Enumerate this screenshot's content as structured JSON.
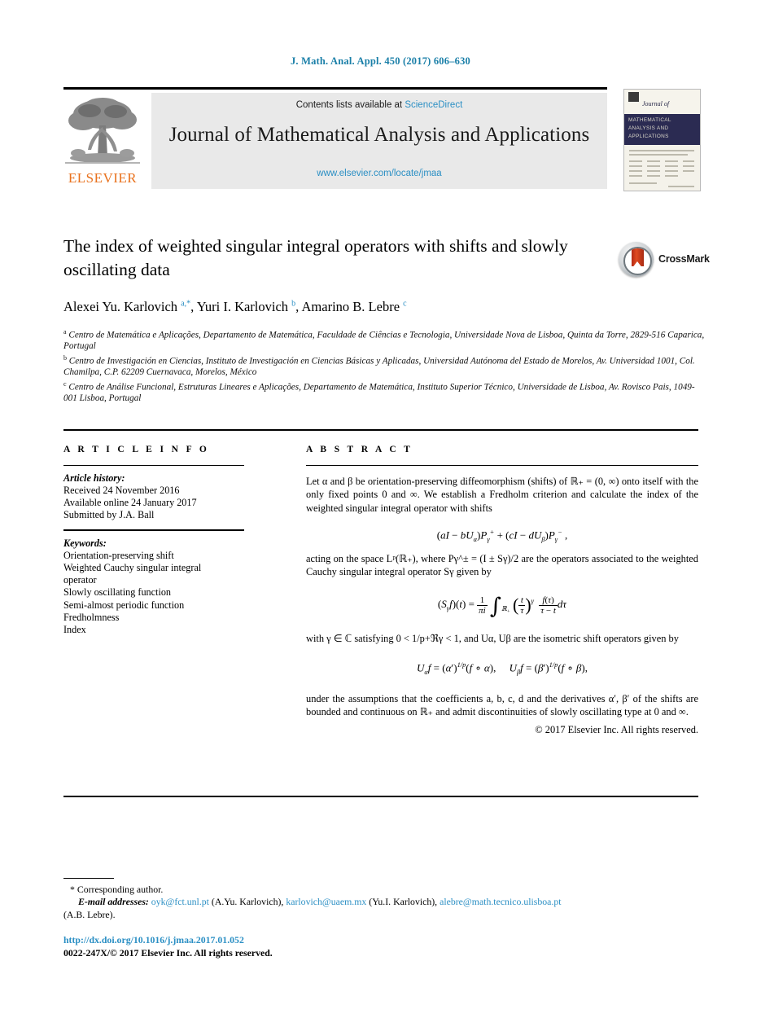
{
  "running_head": "J. Math. Anal. Appl. 450 (2017) 606–630",
  "masthead": {
    "contents_prefix": "Contents lists available at ",
    "sciencedirect": "ScienceDirect",
    "journal_title": "Journal of Mathematical Analysis and Applications",
    "journal_url": "www.elsevier.com/locate/jmaa",
    "publisher": "ELSEVIER",
    "cover": {
      "journal_of": "Journal of",
      "band_title": "MATHEMATICAL ANALYSIS AND APPLICATIONS"
    },
    "link_color": "#2b8fc4"
  },
  "article": {
    "title": "The index of weighted singular integral operators with shifts and slowly oscillating data",
    "crossmark_label": "CrossMark",
    "authors_html": "Alexei Yu. Karlovich <sup>a,*</sup>, Yuri I. Karlovich <sup>b</sup>, Amarino B. Lebre <sup>c</sup>",
    "affiliations": [
      "<sup>a</sup> Centro de Matemática e Aplicações, Departamento de Matemática, Faculdade de Ciências e Tecnologia, Universidade Nova de Lisboa, Quinta da Torre, 2829-516 Caparica, Portugal",
      "<sup>b</sup> Centro de Investigación en Ciencias, Instituto de Investigación en Ciencias Básicas y Aplicadas, Universidad Autónoma del Estado de Morelos, Av. Universidad 1001, Col. Chamilpa, C.P. 62209 Cuernavaca, Morelos, México",
      "<sup>c</sup> Centro de Análise Funcional, Estruturas Lineares e Aplicações, Departamento de Matemática, Instituto Superior Técnico, Universidade de Lisboa, Av. Rovisco Pais, 1049-001 Lisboa, Portugal"
    ]
  },
  "info": {
    "heading": "A R T I C L E    I N F O",
    "history_label": "Article history:",
    "history": [
      "Received 24 November 2016",
      "Available online 24 January 2017",
      "Submitted by J.A. Ball"
    ],
    "keywords_label": "Keywords:",
    "keywords": [
      "Orientation-preserving shift",
      "Weighted Cauchy singular integral",
      "operator",
      "Slowly oscillating function",
      "Semi-almost periodic function",
      "Fredholmness",
      "Index"
    ]
  },
  "abstract": {
    "heading": "A B S T R A C T",
    "paragraph_1": "Let α and β be orientation-preserving diffeomorphism (shifts) of ℝ₊ = (0, ∞) onto itself with the only fixed points 0 and ∞. We establish a Fredholm criterion and calculate the index of the weighted singular integral operator with shifts",
    "paragraph_2": "acting on the space Lᵖ(ℝ₊), where Pγ^± = (I ± Sγ)/2 are the operators associated to the weighted Cauchy singular integral operator Sγ given by",
    "paragraph_3": "with γ ∈ ℂ satisfying 0 < 1/p+ℜγ < 1, and Uα, Uβ are the isometric shift operators given by",
    "paragraph_4": "under the assumptions that the coefficients a, b, c, d and the derivatives α′, β′ of the shifts are bounded and continuous on ℝ₊ and admit discontinuities of slowly oscillating type at 0 and ∞.",
    "copyright": "© 2017 Elsevier Inc. All rights reserved."
  },
  "footnotes": {
    "corresponding": "* Corresponding author.",
    "email_label": "E-mail addresses:",
    "email_1": "oyk@fct.unl.pt",
    "email_1_name": "(A.Yu. Karlovich),",
    "email_2": "karlovich@uaem.mx",
    "email_2_name": "(Yu.I. Karlovich),",
    "email_3": "alebre@math.tecnico.ulisboa.pt",
    "email_3_name": "(A.B. Lebre)."
  },
  "footer": {
    "doi": "http://dx.doi.org/10.1016/j.jmaa.2017.01.052",
    "issn_copyright": "0022-247X/© 2017 Elsevier Inc. All rights reserved."
  }
}
